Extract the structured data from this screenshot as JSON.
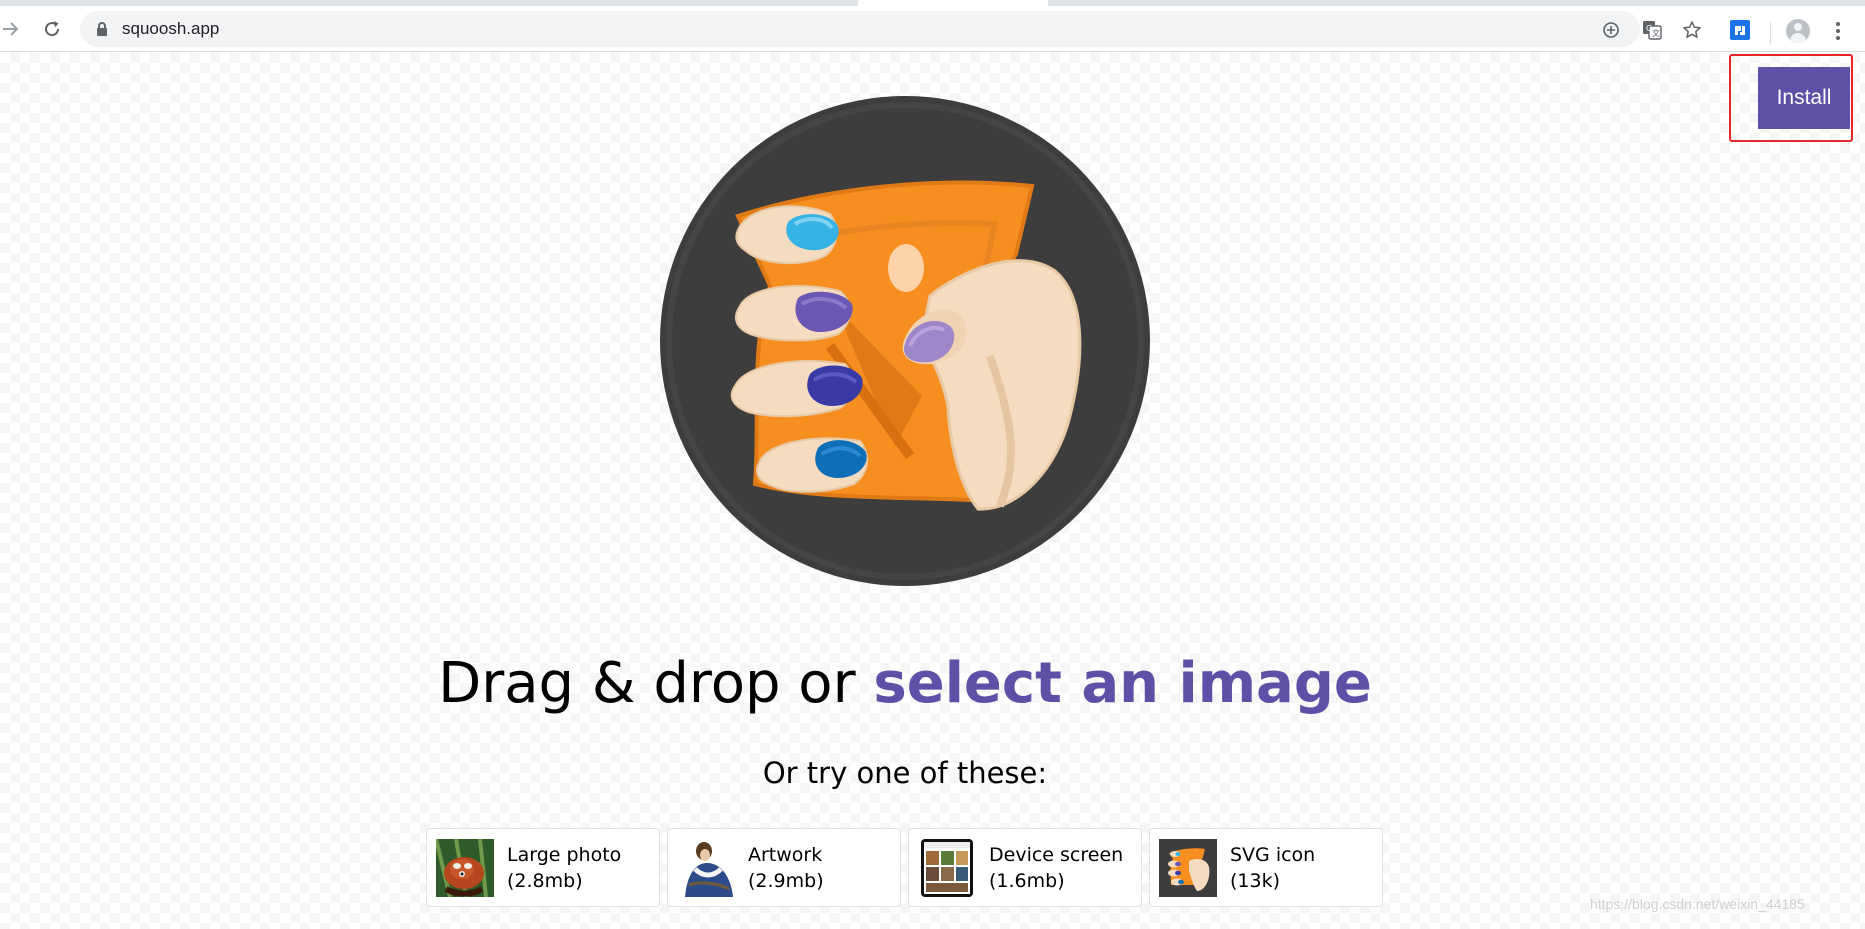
{
  "browser": {
    "url": "squoosh.app",
    "icons": [
      "back-icon",
      "reload-icon",
      "lock-icon",
      "add-icon",
      "translate-icon",
      "star-icon",
      "extension-icon",
      "profile-icon",
      "menu-icon"
    ]
  },
  "header": {
    "install_label": "Install"
  },
  "main": {
    "headline_prefix": "Drag & drop or",
    "headline_link": "select an image",
    "subheading": "Or try one of these:",
    "demos": [
      {
        "title": "Large photo",
        "size": "(2.8mb)"
      },
      {
        "title": "Artwork",
        "size": "(2.9mb)"
      },
      {
        "title": "Device screen",
        "size": "(1.6mb)"
      },
      {
        "title": "SVG icon",
        "size": "(13k)"
      }
    ]
  },
  "watermark": "https://blog.csdn.net/weixin_44185",
  "colors": {
    "accent": "#5f4fa6",
    "highlight_border": "#e8262a",
    "logo_circle": "#3d3d3d",
    "logo_orange": "#f78f20"
  }
}
